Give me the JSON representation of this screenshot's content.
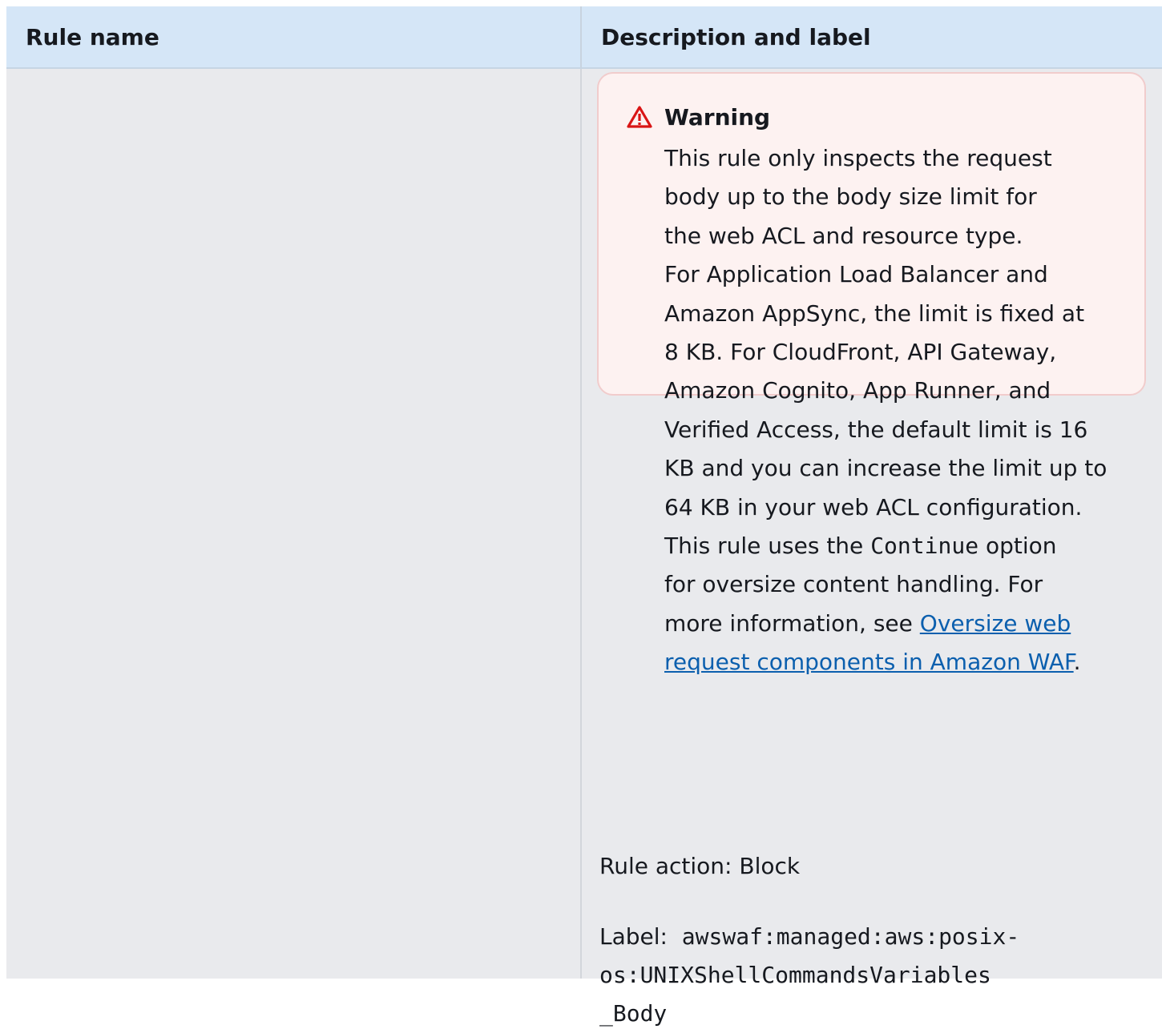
{
  "table": {
    "headers": [
      "Rule name",
      "Description and label"
    ]
  },
  "warning": {
    "icon": "warning-triangle-icon",
    "icon_color": "#d91515",
    "title": "Warning",
    "lines": [
      "This rule only inspects the request",
      "body up to the body size limit for",
      "the web ACL and resource type.",
      "For Application Load Balancer and",
      "Amazon AppSync, the limit is fixed at",
      "8 KB. For CloudFront, API Gateway,",
      "Amazon Cognito, App Runner, and",
      "Verified Access, the default limit is 16",
      "KB and you can increase the limit up to",
      "64 KB in your web ACL configuration."
    ],
    "continue_before": "This rule uses the ",
    "continue_code": "Continue",
    "continue_after": " option",
    "line_oversize": "for oversize content handling. For",
    "more_info_prefix": "more information, see ",
    "link_part1": "Oversize web",
    "link_part2": "request components in Amazon WAF",
    "link_suffix": "."
  },
  "rule_action": "Rule action: Block",
  "label": {
    "prefix": "Label:  ",
    "code_lines": [
      "awswaf:managed:aws:posix-",
      "os:UNIXShellCommandsVariables",
      "_Body"
    ]
  },
  "colors": {
    "header_bg": "#d5e6f7",
    "cell_bg": "#e9eaed",
    "warning_bg": "#fdf2f1",
    "warning_border": "#f1cccc",
    "link": "#0b5fae"
  }
}
